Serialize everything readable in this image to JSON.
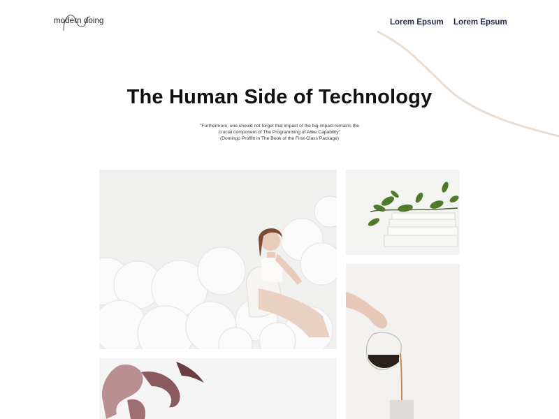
{
  "header": {
    "logo_text": "modern doing",
    "nav": [
      "Lorem Epsum",
      "Lorem Epsum"
    ]
  },
  "hero": {
    "title": "The Human Side of Technology",
    "quote_lines": [
      "\"Furthermore, one should not forget that impact of the big impact remains the",
      "crucial component of The Programming of Alike Capability\"",
      "(Domingo Proffitt in The Book of the First-Class Package)"
    ]
  },
  "gallery": {
    "images": [
      "woman-with-balloons-photo",
      "books-with-plant-photo",
      "coffee-pour-photo",
      "ink-smoke-photo"
    ]
  },
  "colors": {
    "nav_text": "#1d2a4b",
    "accent_curve": "#e9ddd2",
    "background": "#ffffff"
  }
}
